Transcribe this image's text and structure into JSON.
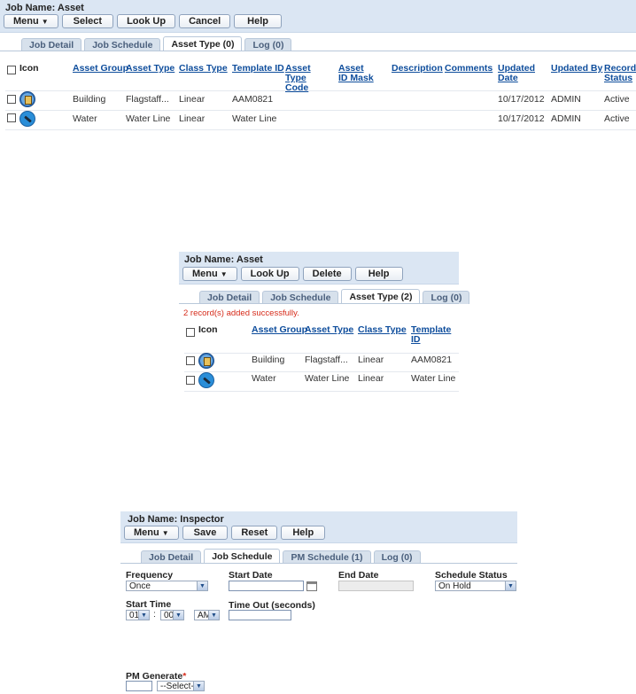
{
  "panel1": {
    "title": "Job Name: Asset",
    "buttons": {
      "menu": "Menu",
      "select": "Select",
      "lookup": "Look Up",
      "cancel": "Cancel",
      "help": "Help"
    },
    "tabs": [
      "Job Detail",
      "Job Schedule",
      "Asset Type (0)",
      "Log (0)"
    ],
    "active_tab": "Asset Type (0)",
    "columns": [
      "Icon",
      "Asset Group",
      "Asset Type",
      "Class Type",
      "Template ID",
      "Asset Type Code",
      "Asset ID Mask",
      "Description",
      "Comments",
      "Updated Date",
      "Updated By",
      "Record Status"
    ],
    "rows": [
      {
        "icon": "building-icon",
        "asset_group": "Building",
        "asset_type": "Flagstaff...",
        "class_type": "Linear",
        "template_id": "AAM0821",
        "updated_date": "10/17/2012",
        "updated_by": "ADMIN",
        "record_status": "Active"
      },
      {
        "icon": "water-line-icon",
        "asset_group": "Water",
        "asset_type": "Water Line",
        "class_type": "Linear",
        "template_id": "Water Line",
        "updated_date": "10/17/2012",
        "updated_by": "ADMIN",
        "record_status": "Active"
      }
    ]
  },
  "panel2": {
    "title": "Job Name: Asset",
    "buttons": {
      "menu": "Menu",
      "lookup": "Look Up",
      "delete": "Delete",
      "help": "Help"
    },
    "tabs": [
      "Job Detail",
      "Job Schedule",
      "Asset Type (2)",
      "Log (0)"
    ],
    "active_tab": "Asset Type (2)",
    "message": "2 record(s) added successfully.",
    "columns": [
      "Icon",
      "Asset Group",
      "Asset Type",
      "Class Type",
      "Template ID"
    ],
    "rows": [
      {
        "icon": "building-icon",
        "asset_group": "Building",
        "asset_type": "Flagstaff...",
        "class_type": "Linear",
        "template_id": "AAM0821"
      },
      {
        "icon": "water-line-icon",
        "asset_group": "Water",
        "asset_type": "Water Line",
        "class_type": "Linear",
        "template_id": "Water Line"
      }
    ]
  },
  "panel3": {
    "title": "Job Name: Inspector",
    "buttons": {
      "menu": "Menu",
      "save": "Save",
      "reset": "Reset",
      "help": "Help"
    },
    "tabs": [
      "Job Detail",
      "Job Schedule",
      "PM Schedule (1)",
      "Log (0)"
    ],
    "active_tab": "Job Schedule",
    "fields": {
      "frequency_label": "Frequency",
      "frequency_value": "Once",
      "start_date_label": "Start Date",
      "start_date_value": "",
      "end_date_label": "End Date",
      "end_date_value": "",
      "schedule_status_label": "Schedule Status",
      "schedule_status_value": "On Hold",
      "start_time_label": "Start Time",
      "hour_value": "01",
      "time_sep": ":",
      "minute_value": "00",
      "ampm_value": "AM",
      "timeout_label": "Time Out (seconds)",
      "timeout_value": "",
      "pm_generate_label": "PM Generate",
      "pm_generate_required": "*",
      "pm_generate_value": "",
      "pm_generate_select": "--Select--"
    }
  },
  "colors": {
    "header_bg": "#dbe6f3",
    "link": "#0e4d9c",
    "success_msg": "#d62b1a",
    "button_border": "#8fa3bd"
  }
}
